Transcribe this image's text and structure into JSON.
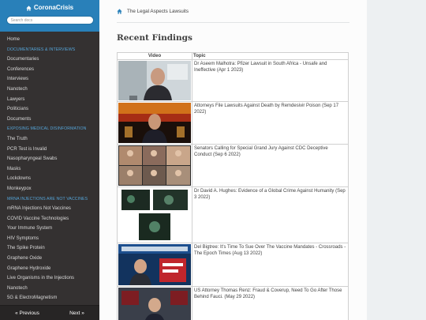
{
  "sidebar": {
    "brand": "CoronaCrisis",
    "search_placeholder": "Search docs",
    "sections": [
      {
        "items": [
          "Home"
        ]
      },
      {
        "caption": "DOCUMENTARIES & INTERVIEWS",
        "items": [
          "Documentaries",
          "Conferences",
          "Interviews",
          "Nanotech",
          "Lawyers",
          "Politicians",
          "Documents"
        ]
      },
      {
        "caption": "EXPOSING MEDICAL DISINFORMATION",
        "items": [
          "The Truth",
          "PCR Test is Invalid",
          "Nasopharyngeal Swabs",
          "Masks",
          "Lockdowns",
          "Monkeypox"
        ]
      },
      {
        "caption": "MRNA INJECTIONS ARE NOT VACCINES",
        "items": [
          "mRNA Injections Not Vaccines",
          "COVID Vaccine Technologies",
          "Your Immune System",
          "HIV Symptoms",
          "The Spike Protein",
          "Graphene Oxide",
          "Graphene Hydroxide",
          "Live Organisms in the Injections",
          "Nanotech",
          "5G & ElectroMagnetism"
        ]
      }
    ],
    "prev": "« Previous",
    "next": "Next »"
  },
  "breadcrumb": "The Legal Aspects Lawsuits",
  "page_title": "Recent Findings",
  "table": {
    "headers": [
      "Video",
      "Topic"
    ],
    "rows": [
      {
        "thumb": "man-office",
        "topic": "Dr Aseem Malhotra: Pfizer Lawsuit in South Africa - Unsafe and Ineffective (Apr 1 2023)"
      },
      {
        "thumb": "fire-stage",
        "topic": "Attorneys File Lawsuits Against Death by Remdesivir Poison (Sep 17 2022)"
      },
      {
        "thumb": "video-grid",
        "topic": "Senators Calling for Special Grand Jury Against CDC Deceptive Conduct (Sep 6 2022)"
      },
      {
        "thumb": "microscopy",
        "topic": "Dr David A. Hughes: Evidence of a Global Crime Against Humanity (Sep 3 2022)"
      },
      {
        "thumb": "news-banner",
        "topic": "Del Bigtree: It's Time To Sue Over The Vaccine Mandates - Crossroads - The Epoch Times (Aug 13 2022)"
      },
      {
        "thumb": "studio",
        "topic": "US Attorney Thomas Renz: Fraud & Coverup, Need To Go After Those Behind Fauci. (May 29 2022)"
      }
    ]
  }
}
